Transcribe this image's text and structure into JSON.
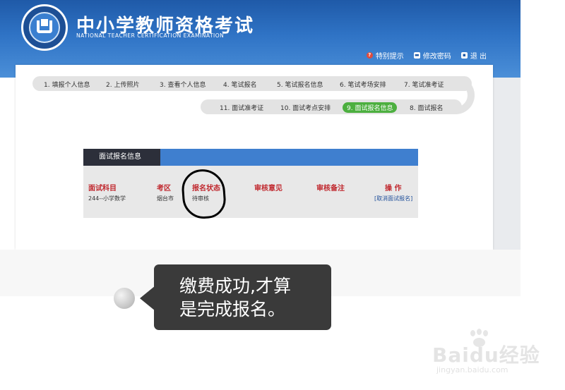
{
  "header": {
    "title": "中小学教师资格考试",
    "subtitle": "NATIONAL TEACHER CERTIFICATION EXAMINATION",
    "links": {
      "special_tips": "特别提示",
      "change_password": "修改密码",
      "exit": "退 出"
    },
    "icons": {
      "special_tips": "?",
      "change_password": "▬",
      "exit": "▪"
    }
  },
  "steps": {
    "row1": [
      "1. 填报个人信息",
      "2. 上传照片",
      "3. 查看个人信息",
      "4. 笔试报名",
      "5. 笔试报名信息",
      "6. 笔试考场安排",
      "7. 笔试准考证"
    ],
    "row2": [
      "11. 面试准考证",
      "10. 面试考点安排",
      "9. 面试报名信息",
      "8. 面试报名"
    ],
    "active": "9. 面试报名信息"
  },
  "card": {
    "tab_title": "面试报名信息",
    "columns": [
      "面试科目",
      "考区",
      "报名状态",
      "审核意见",
      "审核备注",
      "操 作"
    ],
    "row": {
      "subject": "244--小学数学",
      "region": "烟台市",
      "status": "待审核",
      "opinion": "",
      "remark": "",
      "action": "[取消面试报名]"
    }
  },
  "callout": {
    "line1": "缴费成功,才算",
    "line2": "是完成报名。"
  },
  "watermark": {
    "brand": "Baidu经验",
    "url": "jingyan.baidu.com"
  },
  "colors": {
    "header_blue": "#2f73c5",
    "tab_dark": "#2c2f3a",
    "tab_bar_blue": "#3f7fcf",
    "active_step_green": "#4caf3f",
    "column_head_red": "#c0282e",
    "link_blue": "#1f4f9a",
    "bubble_dark": "#3a3a3a"
  }
}
